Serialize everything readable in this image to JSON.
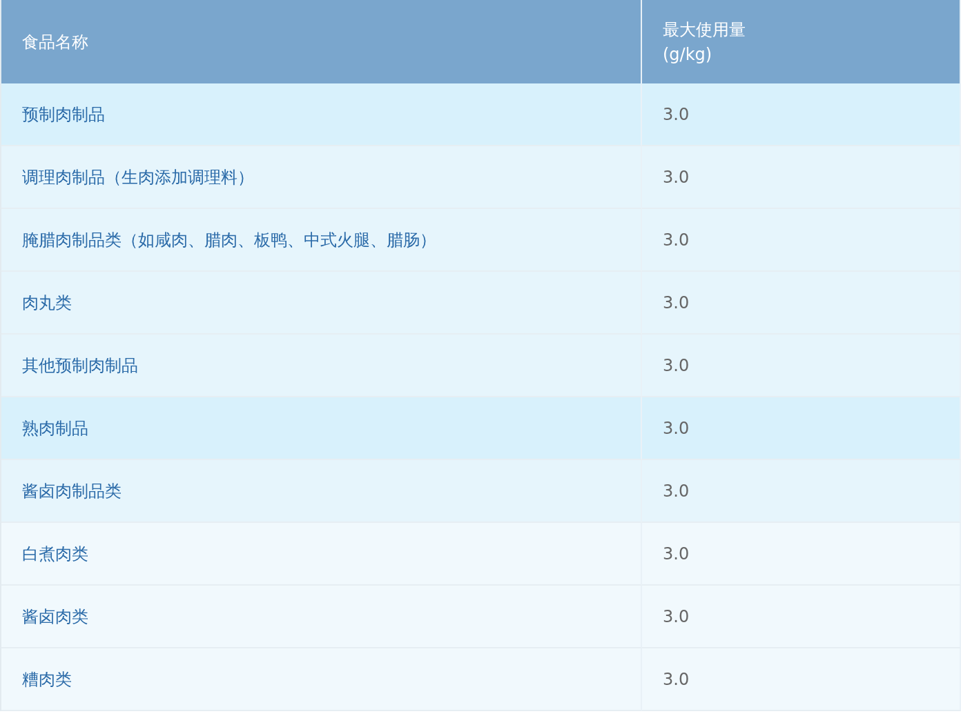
{
  "table": {
    "columns": [
      "食品名称",
      "最大使用量\n(g/kg)"
    ],
    "rows": [
      {
        "name": "预制肉制品",
        "value": "3.0",
        "children": [
          {
            "name": "调理肉制品（生肉添加调理料）",
            "value": "3.0"
          },
          {
            "name": "腌腊肉制品类（如咸肉、腊肉、板鸭、中式火腿、腊肠）",
            "value": "3.0"
          },
          {
            "name": "肉丸类",
            "value": "3.0"
          },
          {
            "name": "其他预制肉制品",
            "value": "3.0"
          }
        ]
      },
      {
        "name": "熟肉制品",
        "value": "3.0",
        "children": [
          {
            "name": "酱卤肉制品类",
            "value": "3.0",
            "children": [
              {
                "name": "白煮肉类",
                "value": "3.0"
              },
              {
                "name": "酱卤肉类",
                "value": "3.0"
              },
              {
                "name": "糟肉类",
                "value": "3.0"
              }
            ]
          }
        ]
      }
    ]
  }
}
